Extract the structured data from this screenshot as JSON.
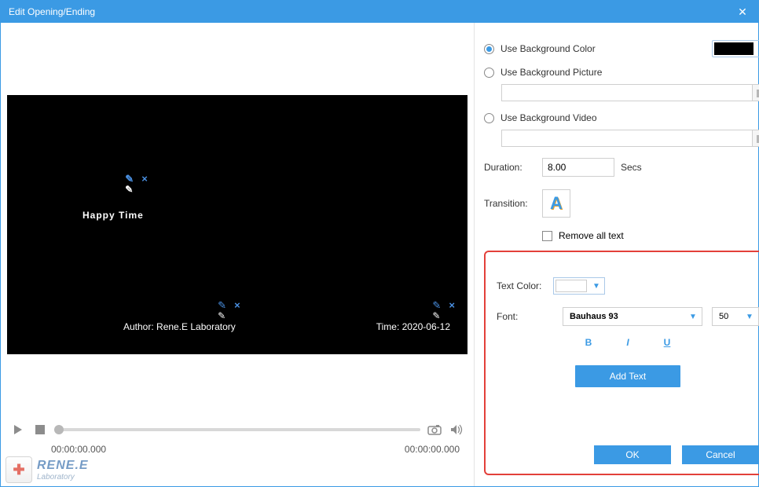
{
  "title": "Edit Opening/Ending",
  "overlay": {
    "main": "Happy Time",
    "author": "Author: Rene.E Laboratory",
    "time": "Time: 2020-06-12"
  },
  "player": {
    "t_left": "00:00:00.000",
    "t_right": "00:00:00.000"
  },
  "watermark": {
    "line1": "RENE.E",
    "line2": "Laboratory"
  },
  "bg": {
    "opt_color": "Use Background Color",
    "opt_picture": "Use Background Picture",
    "opt_video": "Use Background Video",
    "color_value": "#000000",
    "picture_path": "",
    "video_path": ""
  },
  "duration": {
    "label": "Duration:",
    "value": "8.00",
    "unit": "Secs"
  },
  "transition": {
    "label": "Transition:"
  },
  "remove_all": "Remove all text",
  "textcolor": {
    "label": "Text Color:",
    "value": "#ffffff"
  },
  "font": {
    "label": "Font:",
    "name": "Bauhaus 93",
    "size": "50"
  },
  "addtext": "Add Text",
  "ok": "OK",
  "cancel": "Cancel"
}
